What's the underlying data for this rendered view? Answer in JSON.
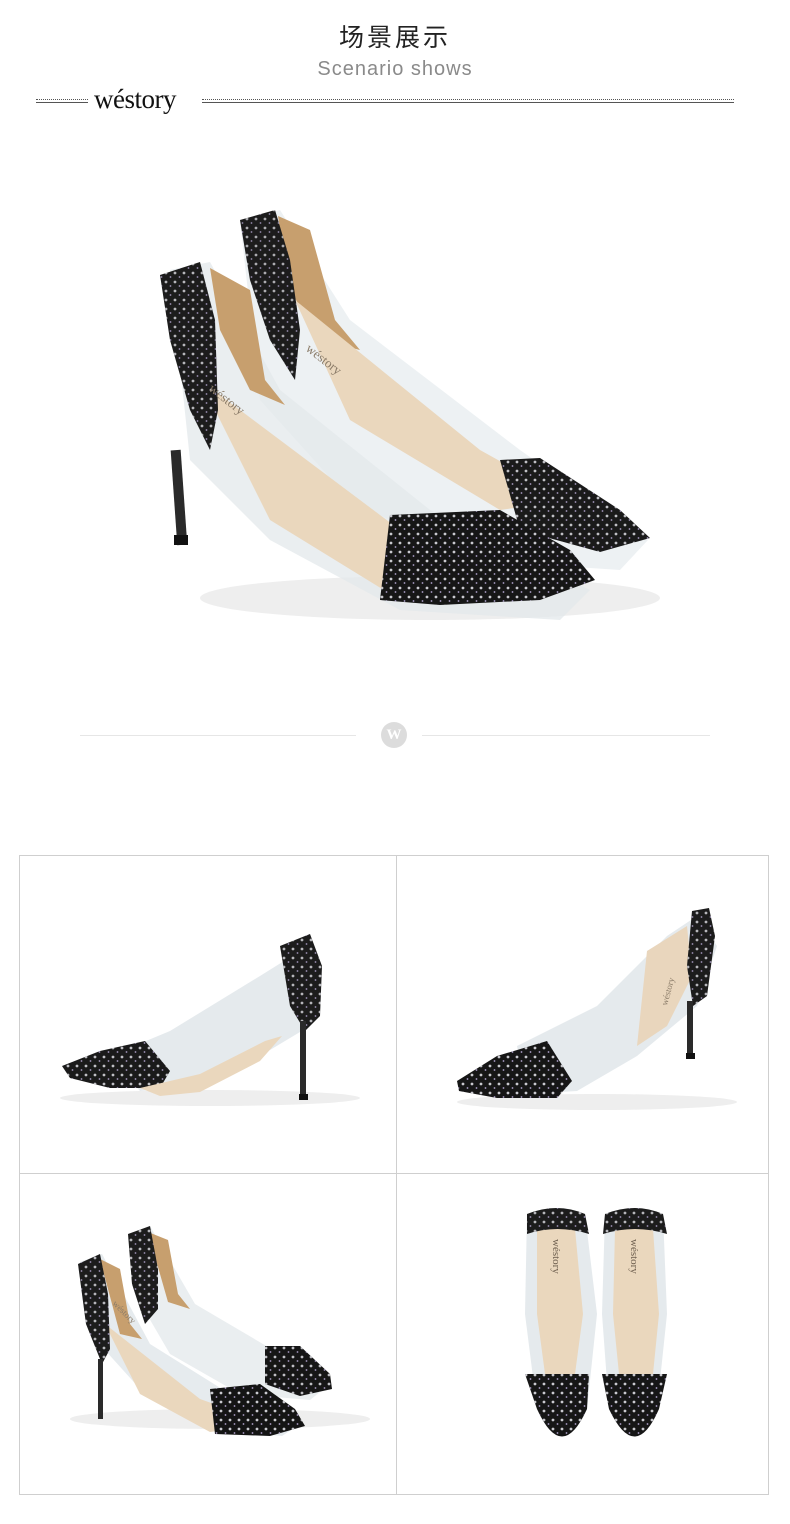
{
  "header": {
    "title_cn": "场景展示",
    "title_en": "Scenario shows"
  },
  "brand": {
    "logo_text": "wéstory",
    "insole_text": "wéstory"
  },
  "divider": {
    "badge_letter": "W"
  },
  "colors": {
    "shoe_black": "#1a1a1a",
    "insole_nude": "#e9d6bd",
    "pvc_clear": "#d8dfe3",
    "rule_gray": "#cfcfcf"
  },
  "gallery": {
    "items": [
      {
        "view": "side-left"
      },
      {
        "view": "side-right"
      },
      {
        "view": "pair-three-quarter"
      },
      {
        "view": "pair-top"
      }
    ]
  }
}
